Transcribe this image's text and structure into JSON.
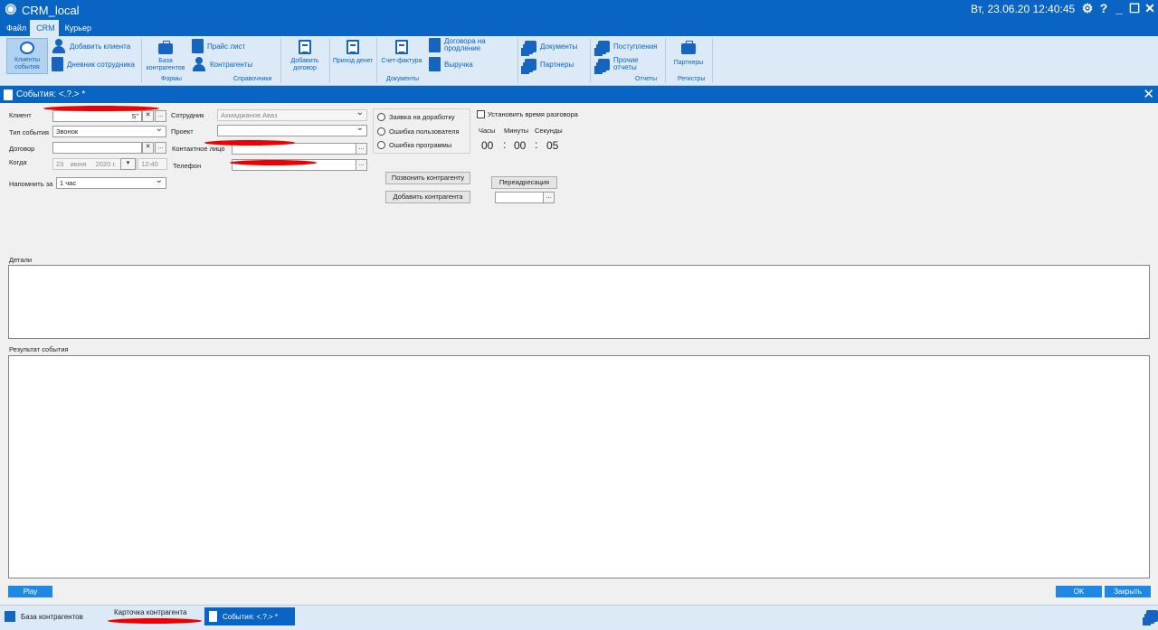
{
  "window": {
    "title": "CRM_local",
    "datetime": "Вт, 23.06.20 12:40:45",
    "icons": [
      "settings-gear-icon",
      "help-icon",
      "minimize-icon",
      "maximize-icon",
      "close-icon"
    ]
  },
  "menu": {
    "items": [
      {
        "label": "Файл",
        "active": false
      },
      {
        "label": "CRM",
        "active": true
      },
      {
        "label": "Курьер",
        "active": false
      }
    ]
  },
  "ribbon": {
    "client_events": "Клиенты события",
    "add_client": "Добавить клиента",
    "employee_diary": "Дневник сотрудника",
    "contractor_base": "База контрагентов",
    "price_list": "Прайс лист",
    "contractors": "Контрагенты",
    "add_contract": "Добавить договор",
    "money_income": "Приход денег",
    "invoice": "Счет-фактура",
    "contracts_renewal": "Договора на продление",
    "revenue": "Выручка",
    "documents": "Документы",
    "partners_small": "Партнеры",
    "receipts": "Поступления",
    "other_reports": "Прочие отчеты",
    "partners": "Партнеры",
    "groups": {
      "forms": "Формы",
      "references": "Справочники",
      "documents": "Документы",
      "reports": "Отчеты",
      "registers": "Регистры"
    }
  },
  "document": {
    "title": "События: <.?.> *"
  },
  "form": {
    "client_label": "Клиент",
    "client_value": "S\"",
    "event_type_label": "Тип события",
    "event_type_value": "Звонок",
    "contract_label": "Договор",
    "contract_value": "",
    "when_label": "Когда",
    "when_day": "23",
    "when_month": "июня",
    "when_year": "2020 г.",
    "when_time": "12:40",
    "remind_label": "Напомнить за",
    "remind_value": "1 час",
    "employee_label": "Сотрудник",
    "employee_value": "Ахмаджанов Аваз",
    "project_label": "Проект",
    "project_value": "",
    "contact_label": "Контактное лицо",
    "phone_label": "Телефон",
    "radios": [
      "Заявка на доработку",
      "Ошибка пользователя",
      "Ошибка программы"
    ],
    "set_time_label": "Установить время разговора",
    "timer": {
      "hours_label": "Часы",
      "minutes_label": "Минуты",
      "seconds_label": "Секунды",
      "hours": "00",
      "minutes": "00",
      "seconds": "05",
      "sep": ":"
    },
    "call_contractor": "Позвонить контрагенту",
    "add_contractor": "Добавить контрагента",
    "redirect": "Переадресация",
    "details_label": "Детали",
    "result_label": "Результат события"
  },
  "footer": {
    "play": "Play",
    "ok": "OK",
    "close": "Закрыть"
  },
  "taskbar": {
    "tasks": [
      {
        "label": "База контрагентов"
      },
      {
        "label": "Карточка контрагента"
      },
      {
        "label": "События: <.?.> *"
      }
    ]
  },
  "colors": {
    "accent": "#0a64c4",
    "ribbon_bg": "#dce9f6",
    "button_blue": "#1e88e5",
    "annotation_red": "#e00000"
  }
}
